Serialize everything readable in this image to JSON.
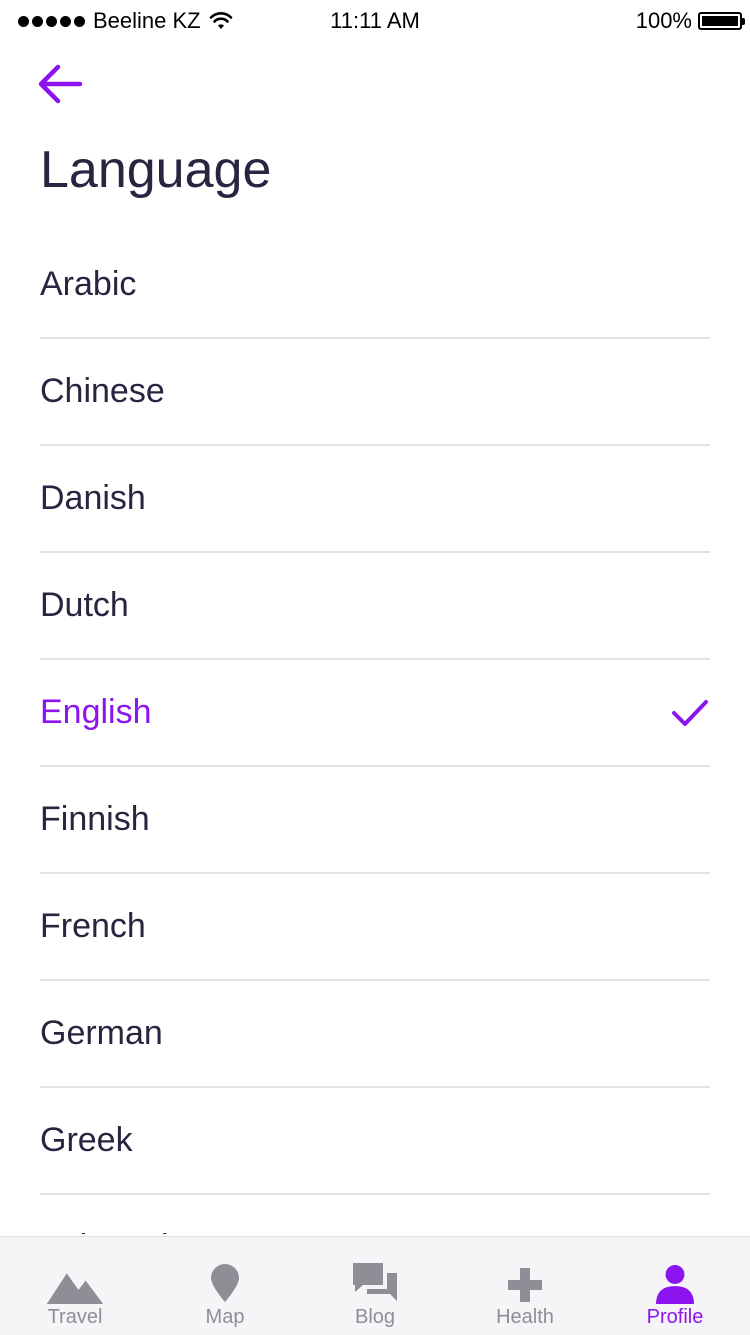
{
  "status_bar": {
    "carrier": "Beeline KZ",
    "time": "11:11 AM",
    "battery": "100%"
  },
  "header": {
    "title": "Language"
  },
  "languages": [
    {
      "label": "Arabic",
      "selected": false
    },
    {
      "label": "Chinese",
      "selected": false
    },
    {
      "label": "Danish",
      "selected": false
    },
    {
      "label": "Dutch",
      "selected": false
    },
    {
      "label": "English",
      "selected": true
    },
    {
      "label": "Finnish",
      "selected": false
    },
    {
      "label": "French",
      "selected": false
    },
    {
      "label": "German",
      "selected": false
    },
    {
      "label": "Greek",
      "selected": false
    },
    {
      "label": "Indonesian",
      "selected": false
    }
  ],
  "tab_bar": {
    "items": [
      {
        "label": "Travel",
        "icon": "mountain-icon",
        "active": false
      },
      {
        "label": "Map",
        "icon": "map-pin-icon",
        "active": false
      },
      {
        "label": "Blog",
        "icon": "chat-bubbles-icon",
        "active": false
      },
      {
        "label": "Health",
        "icon": "plus-icon",
        "active": false
      },
      {
        "label": "Profile",
        "icon": "person-icon",
        "active": true
      }
    ]
  },
  "colors": {
    "accent": "#8c14ef",
    "text": "#262640",
    "inactive": "#8e8e96",
    "divider": "#e2e2e6"
  }
}
